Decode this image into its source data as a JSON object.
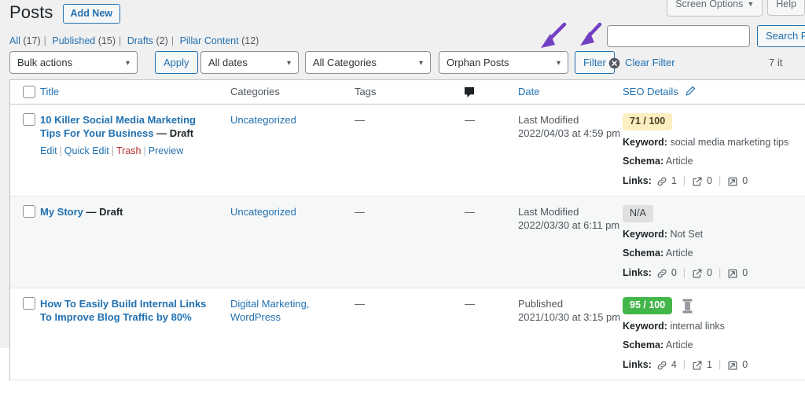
{
  "screen_meta": [
    {
      "label": "Screen Options",
      "caret": "▼",
      "icon": "chevron-down-icon"
    },
    {
      "label": "Help",
      "caret": "",
      "icon": ""
    }
  ],
  "header": {
    "title": "Posts",
    "add_new_label": "Add New"
  },
  "status_links": [
    {
      "label": "All",
      "count": "(17)"
    },
    {
      "label": "Published",
      "count": "(15)"
    },
    {
      "label": "Drafts",
      "count": "(2)"
    },
    {
      "label": "Pillar Content",
      "count": "(12)"
    }
  ],
  "toolbar": {
    "bulk_actions": "Bulk actions",
    "apply_label": "Apply",
    "dates_filter": "All dates",
    "categories_filter": "All Categories",
    "orphan_filter": "Orphan Posts",
    "filter_label": "Filter",
    "clear_filter_label": "Clear Filter",
    "clear_filter_icon": "x-circle-icon",
    "search_value": "",
    "search_placeholder": "",
    "search_button_label": "Search Po",
    "items_count": "7 it"
  },
  "table": {
    "columns": {
      "title": "Title",
      "categories": "Categories",
      "tags": "Tags",
      "comments_icon": "comment-bubble-icon",
      "date": "Date",
      "seo_details": "SEO Details",
      "seo_edit_icon": "pencil-icon"
    },
    "rows": [
      {
        "title": "10 Killer Social Media Marketing Tips For Your Business",
        "state": "— Draft",
        "actions": {
          "edit": "Edit",
          "quick_edit": "Quick Edit",
          "trash": "Trash",
          "preview": "Preview"
        },
        "categories": "Uncategorized",
        "tags": "—",
        "comments": "—",
        "date_state": "Last Modified",
        "date_value": "2022/04/03 at 4:59 pm",
        "seo": {
          "score": "71 / 100",
          "score_style": "yellow",
          "score_color": "#fbeec0",
          "pillar": false,
          "keyword_label": "Keyword:",
          "keyword_value": "social media marketing tips",
          "schema_label": "Schema:",
          "schema_value": "Article",
          "links_label": "Links:",
          "internal_links": "1",
          "external_links": "0",
          "incoming_links": "0"
        }
      },
      {
        "title": "My Story",
        "state": "— Draft",
        "actions": null,
        "categories": "Uncategorized",
        "tags": "—",
        "comments": "—",
        "date_state": "Last Modified",
        "date_value": "2022/03/30 at 6:11 pm",
        "seo": {
          "score": "N/A",
          "score_style": "gray",
          "score_color": "#e0e0e0",
          "pillar": false,
          "keyword_label": "Keyword:",
          "keyword_value": "Not Set",
          "schema_label": "Schema:",
          "schema_value": "Article",
          "links_label": "Links:",
          "internal_links": "0",
          "external_links": "0",
          "incoming_links": "0"
        }
      },
      {
        "title": "How To Easily Build Internal Links To Improve Blog Traffic by 80%",
        "state": "",
        "actions": null,
        "categories": "Digital Marketing, WordPress",
        "tags": "—",
        "comments": "—",
        "date_state": "Published",
        "date_value": "2021/10/30 at 3:15 pm",
        "seo": {
          "score": "95 / 100",
          "score_style": "green",
          "score_color": "#43b649",
          "pillar": true,
          "pillar_icon": "pillar-column-icon",
          "keyword_label": "Keyword:",
          "keyword_value": "internal links",
          "schema_label": "Schema:",
          "schema_value": "Article",
          "links_label": "Links:",
          "internal_links": "4",
          "external_links": "1",
          "incoming_links": "0"
        }
      }
    ]
  },
  "annotations": {
    "arrow_color": "#7340c4",
    "arrows": [
      {
        "name": "arrow-to-orphan-filter"
      },
      {
        "name": "arrow-to-filter-button"
      }
    ]
  }
}
